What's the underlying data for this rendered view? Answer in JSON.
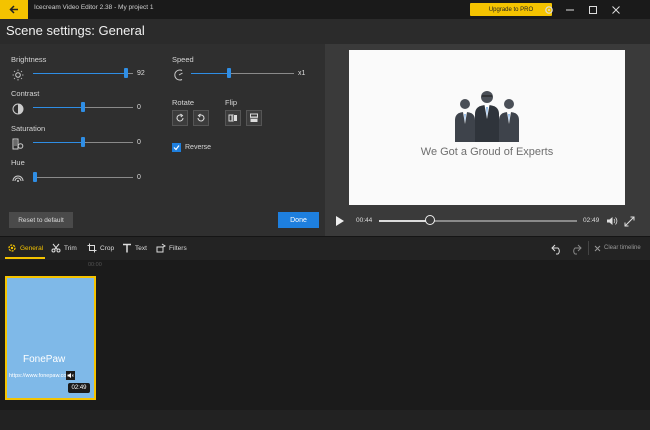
{
  "window": {
    "app_title": "Icecream Video Editor 2.38  -  My project 1",
    "upgrade_label": "Upgrade to PRO"
  },
  "header": {
    "title": "Scene settings: General"
  },
  "settings": {
    "brightness": {
      "label": "Brightness",
      "value": "92",
      "level": 0.95
    },
    "contrast": {
      "label": "Contrast",
      "value": "0",
      "level": 0.5
    },
    "saturation": {
      "label": "Saturation",
      "value": "0",
      "level": 0.5
    },
    "hue": {
      "label": "Hue",
      "value": "0",
      "level": 0.0
    },
    "speed": {
      "label": "Speed",
      "value": "x1",
      "level": 0.36
    },
    "rotate_label": "Rotate",
    "flip_label": "Flip",
    "reverse_label": "Reverse",
    "reverse_checked": true,
    "reset_label": "Reset to default",
    "done_label": "Done"
  },
  "preview": {
    "video_text": "We Got a Groud of Experts",
    "current_time": "00:44",
    "total_time": "02:49",
    "progress": 0.26
  },
  "toolbar": {
    "tabs": [
      "General",
      "Trim",
      "Crop",
      "Text",
      "Filters"
    ],
    "clear_label": "Clear timeline"
  },
  "timeline": {
    "ruler_label": "00:00",
    "clip": {
      "logo": "FonePaw",
      "url": "https://www.fonepaw.co",
      "duration": "02:49"
    }
  },
  "colors": {
    "accent_yellow": "#f4c300",
    "accent_blue": "#1e7fde",
    "clip_blue": "#7fb9e8"
  }
}
